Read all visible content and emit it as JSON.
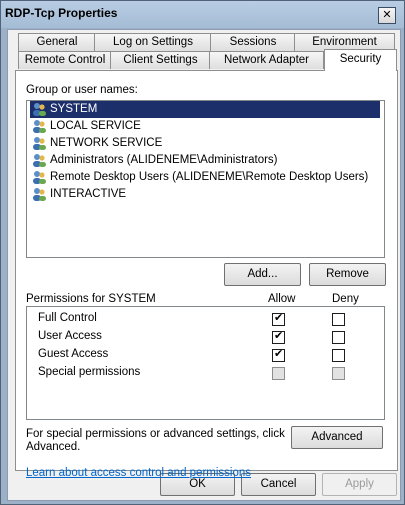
{
  "window": {
    "title": "RDP-Tcp Properties",
    "close_glyph": "✕"
  },
  "tabs_row1": [
    {
      "label": "General"
    },
    {
      "label": "Log on Settings"
    },
    {
      "label": "Sessions"
    },
    {
      "label": "Environment"
    }
  ],
  "tabs_row2": [
    {
      "label": "Remote Control"
    },
    {
      "label": "Client Settings"
    },
    {
      "label": "Network Adapter"
    },
    {
      "label": "Security",
      "active": true
    }
  ],
  "groups": {
    "label": "Group or user names:",
    "items": [
      {
        "name": "SYSTEM",
        "selected": true
      },
      {
        "name": "LOCAL SERVICE"
      },
      {
        "name": "NETWORK SERVICE"
      },
      {
        "name": "Administrators (ALIDENEME\\Administrators)"
      },
      {
        "name": "Remote Desktop Users (ALIDENEME\\Remote Desktop Users)"
      },
      {
        "name": "INTERACTIVE"
      }
    ],
    "add_label": "Add...",
    "remove_label": "Remove"
  },
  "permissions": {
    "title": "Permissions for SYSTEM",
    "allow_header": "Allow",
    "deny_header": "Deny",
    "rows": [
      {
        "name": "Full Control",
        "allow": true,
        "deny": false
      },
      {
        "name": "User Access",
        "allow": true,
        "deny": false
      },
      {
        "name": "Guest Access",
        "allow": true,
        "deny": false
      },
      {
        "name": "Special permissions",
        "allow": false,
        "deny": false,
        "disabled": true
      }
    ]
  },
  "advanced": {
    "text_line1": "For special permissions or advanced settings, click",
    "text_line2": "Advanced.",
    "button_label": "Advanced"
  },
  "link_text": "Learn about access control and permissions",
  "footer": {
    "ok": "OK",
    "cancel": "Cancel",
    "apply": "Apply"
  },
  "check_glyph": "✔"
}
